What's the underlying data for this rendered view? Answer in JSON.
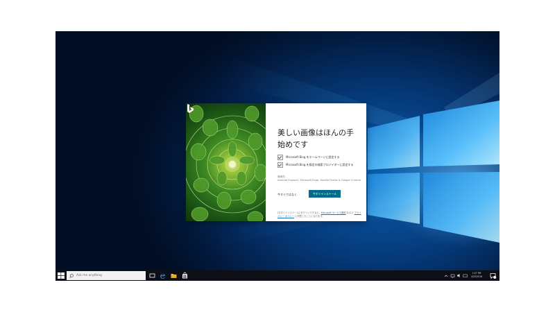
{
  "dialog": {
    "title": "美しい画像はほんの手始めです",
    "options": [
      {
        "label": "Microsoft Bing をホームページに設定する",
        "checked": true
      },
      {
        "label": "Microsoft Bing を既定の検索プロバイダーに設定する",
        "checked": true
      }
    ],
    "applies_label": "適用先:",
    "applies_browsers": "Internet Explorer, Microsoft Edge, Mozilla Firefox & Google Chrome",
    "later_label": "今すぐではなく",
    "install_label": "今すぐインストール",
    "legal": {
      "prefix": "[今すぐインストール] をクリックすると、",
      "link1": "Microsoft サービス規約",
      "middle": " および ",
      "link2": "プライバシー ポリシー",
      "suffix": " に同意したことになります。"
    }
  },
  "taskbar": {
    "search_placeholder": "Ask me anything",
    "pinned_icons": [
      "task-view-icon",
      "edge-icon",
      "file-explorer-icon",
      "store-icon"
    ],
    "tray_icons": [
      "chevron-up-icon",
      "network-icon",
      "volume-icon",
      "keyboard-icon"
    ],
    "time": "1:07 PM",
    "date": "4/20/2016"
  },
  "colors": {
    "install_button": "#006b8a",
    "taskbar": "#0c0f16",
    "desktop_blue": "#0a5fb0"
  }
}
